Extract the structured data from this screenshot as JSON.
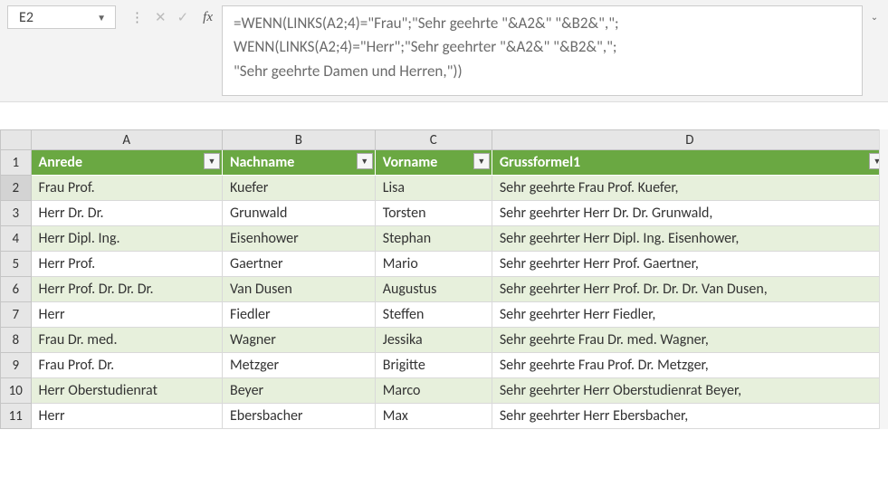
{
  "name_box": "E2",
  "fx_label": "fx",
  "formula": "=WENN(LINKS(A2;4)=\"Frau\";\"Sehr geehrte \"&A2&\" \"&B2&\",\";\nWENN(LINKS(A2;4)=\"Herr\";\"Sehr geehrter \"&A2&\" \"&B2&\",\";\n\"Sehr geehrte Damen und Herren,\"))",
  "columns": [
    "A",
    "B",
    "C",
    "D"
  ],
  "row_numbers": [
    "1",
    "2",
    "3",
    "4",
    "5",
    "6",
    "7",
    "8",
    "9",
    "10",
    "11"
  ],
  "headers": {
    "anrede": "Anrede",
    "nachname": "Nachname",
    "vorname": "Vorname",
    "gruss": "Grussformel1"
  },
  "rows": [
    {
      "anrede": "Frau Prof.",
      "nachname": "Kuefer",
      "vorname": "Lisa",
      "gruss": "Sehr geehrte Frau Prof. Kuefer,"
    },
    {
      "anrede": "Herr Dr. Dr.",
      "nachname": "Grunwald",
      "vorname": "Torsten",
      "gruss": "Sehr geehrter Herr Dr. Dr. Grunwald,"
    },
    {
      "anrede": "Herr Dipl. Ing.",
      "nachname": "Eisenhower",
      "vorname": "Stephan",
      "gruss": "Sehr geehrter Herr Dipl. Ing. Eisenhower,"
    },
    {
      "anrede": "Herr Prof.",
      "nachname": "Gaertner",
      "vorname": "Mario",
      "gruss": "Sehr geehrter Herr Prof. Gaertner,"
    },
    {
      "anrede": "Herr Prof. Dr. Dr. Dr.",
      "nachname": "Van Dusen",
      "vorname": "Augustus",
      "gruss": "Sehr geehrter Herr Prof. Dr. Dr. Dr. Van Dusen,"
    },
    {
      "anrede": "Herr",
      "nachname": "Fiedler",
      "vorname": "Steffen",
      "gruss": "Sehr geehrter Herr Fiedler,"
    },
    {
      "anrede": "Frau Dr. med.",
      "nachname": "Wagner",
      "vorname": "Jessika",
      "gruss": "Sehr geehrte Frau Dr. med. Wagner,"
    },
    {
      "anrede": "Frau Prof. Dr.",
      "nachname": "Metzger",
      "vorname": "Brigitte",
      "gruss": "Sehr geehrte Frau Prof. Dr. Metzger,"
    },
    {
      "anrede": "Herr Oberstudienrat",
      "nachname": "Beyer",
      "vorname": "Marco",
      "gruss": "Sehr geehrter Herr Oberstudienrat Beyer,"
    },
    {
      "anrede": "Herr",
      "nachname": "Ebersbacher",
      "vorname": "Max",
      "gruss": "Sehr geehrter Herr Ebersbacher,"
    }
  ],
  "chart_data": {
    "type": "table",
    "columns": [
      "Anrede",
      "Nachname",
      "Vorname",
      "Grussformel1"
    ],
    "rows": [
      [
        "Frau Prof.",
        "Kuefer",
        "Lisa",
        "Sehr geehrte Frau Prof. Kuefer,"
      ],
      [
        "Herr Dr. Dr.",
        "Grunwald",
        "Torsten",
        "Sehr geehrter Herr Dr. Dr. Grunwald,"
      ],
      [
        "Herr Dipl. Ing.",
        "Eisenhower",
        "Stephan",
        "Sehr geehrter Herr Dipl. Ing. Eisenhower,"
      ],
      [
        "Herr Prof.",
        "Gaertner",
        "Mario",
        "Sehr geehrter Herr Prof. Gaertner,"
      ],
      [
        "Herr Prof. Dr. Dr. Dr.",
        "Van Dusen",
        "Augustus",
        "Sehr geehrter Herr Prof. Dr. Dr. Dr. Van Dusen,"
      ],
      [
        "Herr",
        "Fiedler",
        "Steffen",
        "Sehr geehrter Herr Fiedler,"
      ],
      [
        "Frau Dr. med.",
        "Wagner",
        "Jessika",
        "Sehr geehrte Frau Dr. med. Wagner,"
      ],
      [
        "Frau Prof. Dr.",
        "Metzger",
        "Brigitte",
        "Sehr geehrte Frau Prof. Dr. Metzger,"
      ],
      [
        "Herr Oberstudienrat",
        "Beyer",
        "Marco",
        "Sehr geehrter Herr Oberstudienrat Beyer,"
      ],
      [
        "Herr",
        "Ebersbacher",
        "Max",
        "Sehr geehrter Herr Ebersbacher,"
      ]
    ]
  }
}
